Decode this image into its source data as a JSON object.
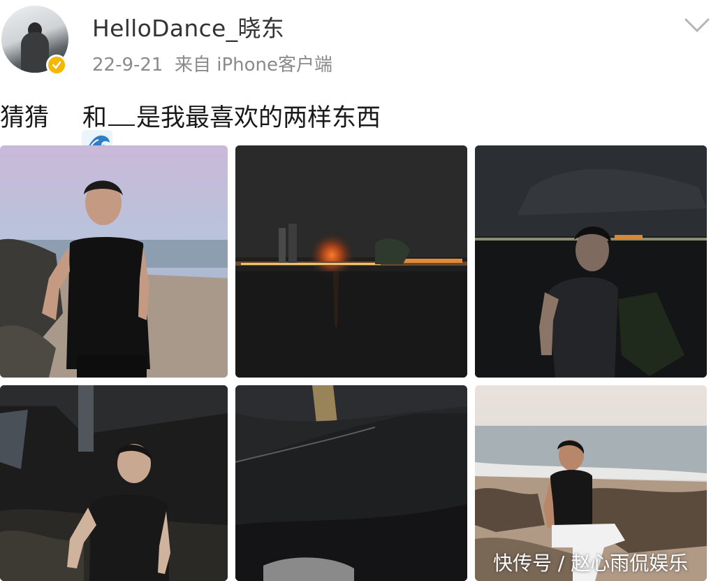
{
  "post": {
    "username": "HelloDance_晓东",
    "meta": "22-9-21  来自 iPhone客户端",
    "text_before": "猜猜",
    "wave_icon": "water-wave-emoji",
    "text_after": "和__是我最喜欢的两样东西"
  },
  "icons": {
    "verified": "verified-badge-icon",
    "menu": "chevron-down-icon"
  },
  "colors": {
    "badge": "#f5b800",
    "meta_text": "#8a8a8a"
  },
  "photos": [
    {
      "id": "photo-1",
      "alt": "man on beach at dusk"
    },
    {
      "id": "photo-2",
      "alt": "night sea with city lights"
    },
    {
      "id": "photo-3",
      "alt": "man by night sea"
    },
    {
      "id": "photo-4",
      "alt": "man on rocks at night"
    },
    {
      "id": "photo-5",
      "alt": "moonlit shoreline"
    },
    {
      "id": "photo-6",
      "alt": "man sitting on beach rocks"
    }
  ],
  "watermark": "快传号 / 赵心雨侃娱乐"
}
